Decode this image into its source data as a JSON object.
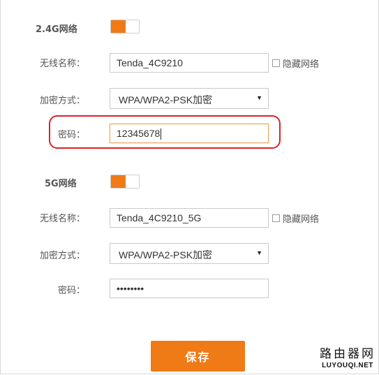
{
  "colors": {
    "accent": "#f07a16",
    "highlight": "#d9222a"
  },
  "network_24": {
    "title": "2.4G网络",
    "enabled": true,
    "ssid_label": "无线名称：",
    "ssid_value": "Tenda_4C9210",
    "hide_label": "隐藏网络",
    "enc_label": "加密方式：",
    "enc_value": "WPA/WPA2-PSK加密",
    "pwd_label": "密码：",
    "pwd_value": "12345678"
  },
  "network_5g": {
    "title": "5G网络",
    "enabled": true,
    "ssid_label": "无线名称：",
    "ssid_value": "Tenda_4C9210_5G",
    "hide_label": "隐藏网络",
    "enc_label": "加密方式：",
    "enc_value": "WPA/WPA2-PSK加密",
    "pwd_label": "密码：",
    "pwd_value": "••••••••"
  },
  "save_label": "保存",
  "watermark": {
    "cn": "路由器网",
    "en": "LUYOUQI.NET"
  }
}
